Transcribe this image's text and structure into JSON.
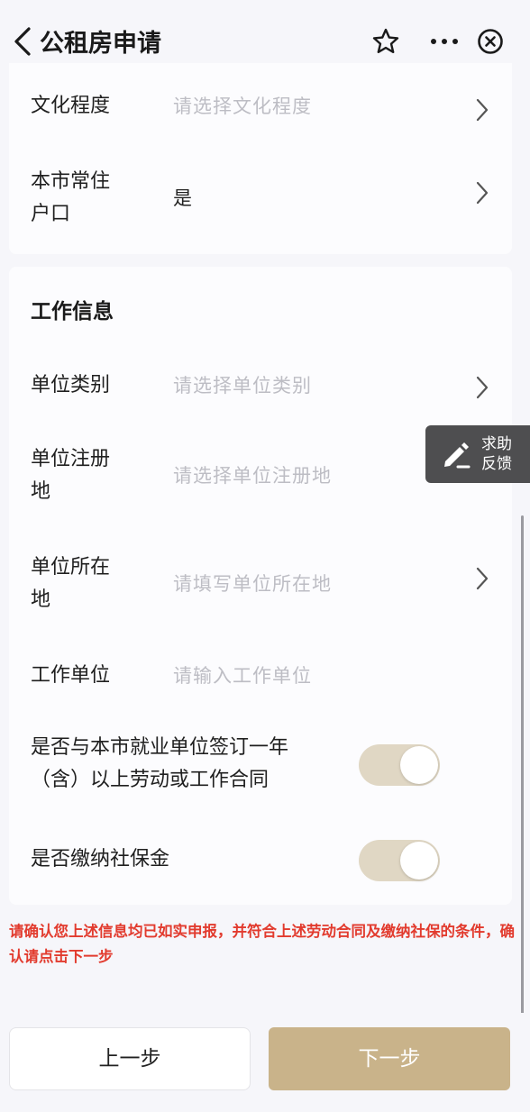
{
  "header": {
    "title": "公租房申请"
  },
  "personal": {
    "education": {
      "label": "文化程度",
      "placeholder": "请选择文化程度"
    },
    "hukou": {
      "label_line1": "本市常住",
      "label_line2": "户口",
      "value": "是"
    }
  },
  "work": {
    "section_title": "工作信息",
    "unit_type": {
      "label": "单位类别",
      "placeholder": "请选择单位类别"
    },
    "unit_reg": {
      "label_line1": "单位注册",
      "label_line2": "地",
      "placeholder": "请选择单位注册地"
    },
    "unit_loc": {
      "label_line1": "单位所在",
      "label_line2": "地",
      "placeholder": "请填写单位所在地"
    },
    "employer": {
      "label": "工作单位",
      "placeholder": "请输入工作单位"
    },
    "contract": {
      "label_line1": "是否与本市就业单位签订一年",
      "label_line2": "（含）以上劳动或工作合同",
      "toggled": true
    },
    "social_insurance": {
      "label": "是否缴纳社保金",
      "toggled": true
    }
  },
  "notice": "请确认您上述信息均已如实申报，并符合上述劳动合同及缴纳社保的条件，确认请点击下一步",
  "feedback": {
    "line1": "求助",
    "line2": "反馈"
  },
  "buttons": {
    "prev": "上一步",
    "next": "下一步"
  },
  "colors": {
    "accent": "#c9b38a",
    "toggle_bg": "#e0d7c4",
    "notice": "#e23b2e",
    "placeholder": "#bdbdc4"
  }
}
